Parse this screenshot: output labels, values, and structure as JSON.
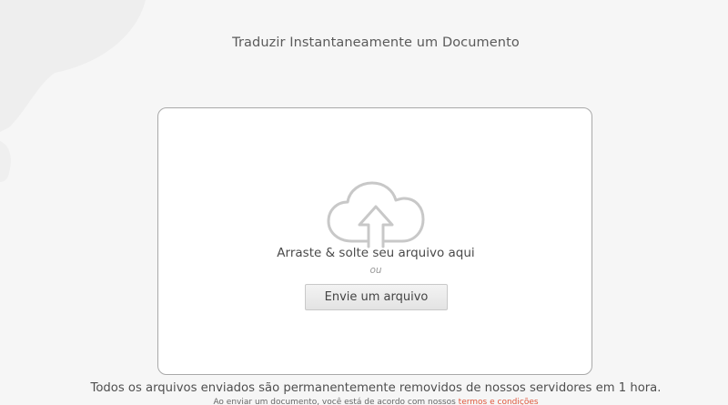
{
  "header": {
    "title": "Traduzir Instantaneamente um Documento"
  },
  "drop_zone": {
    "icon": "cloud-upload-icon",
    "drag_text": "Arraste & solte seu arquivo aqui",
    "or_text": "ou",
    "upload_button_label": "Envie um arquivo"
  },
  "footer": {
    "notice": "Todos os arquivos enviados são permanentemente removidos de nossos servidores em 1 hora.",
    "terms_prefix": "Ao enviar um documento, você está de acordo com nossos",
    "terms_link": "termos e condições"
  },
  "colors": {
    "background": "#f6f6f6",
    "link": "#e0573c",
    "border": "#a9a9a9"
  }
}
